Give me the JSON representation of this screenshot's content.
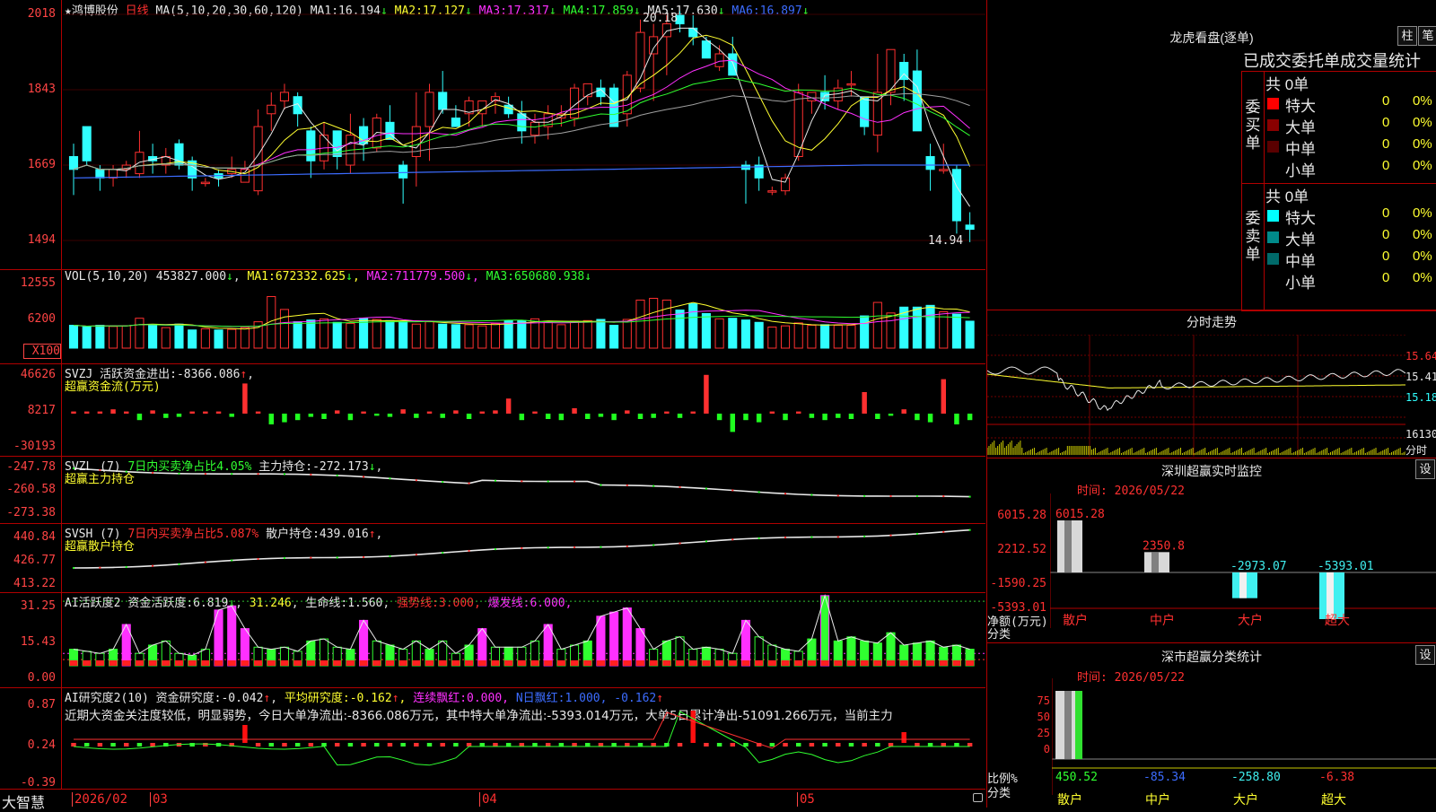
{
  "colors": {
    "up": "#ff3030",
    "down": "#30ffff",
    "ma1": "#e8e8e8",
    "ma2": "#ffff30",
    "ma3": "#ff30ff",
    "ma4": "#30ff30",
    "ma5": "#a0a0a0",
    "ma6": "#3c6cff",
    "grid": "#b00000"
  },
  "main": {
    "star": "★",
    "stock_name": "鸿博股份",
    "period": "日线",
    "ma_params": "MA(5,10,20,30,60,120)",
    "ma": [
      {
        "label": "MA1:",
        "value": "16.194"
      },
      {
        "label": "MA2:",
        "value": "17.127"
      },
      {
        "label": "MA3:",
        "value": "17.317"
      },
      {
        "label": "MA4:",
        "value": "17.859"
      },
      {
        "label": "MA5:",
        "value": "17.630"
      },
      {
        "label": "MA6:",
        "value": "16.897"
      }
    ],
    "arrow_down": "↓",
    "arrow_up": "↑",
    "ticks": [
      "2018",
      "1843",
      "1669",
      "1494"
    ],
    "high_label": "20.18",
    "low_label": "14.94"
  },
  "candles": [
    [
      16.9,
      17.2,
      16.0,
      16.6
    ],
    [
      17.6,
      17.3,
      16.7,
      16.8
    ],
    [
      16.6,
      16.7,
      16.1,
      16.4
    ],
    [
      16.4,
      16.7,
      16.2,
      16.6
    ],
    [
      16.6,
      16.8,
      16.4,
      16.7
    ],
    [
      16.5,
      17.5,
      16.4,
      17.0
    ],
    [
      16.9,
      17.2,
      16.5,
      16.8
    ],
    [
      16.7,
      17.1,
      16.5,
      16.9
    ],
    [
      17.2,
      17.3,
      16.6,
      16.7
    ],
    [
      16.8,
      16.9,
      16.1,
      16.4
    ],
    [
      16.3,
      16.4,
      16.2,
      16.3
    ],
    [
      16.5,
      16.6,
      16.2,
      16.4
    ],
    [
      16.5,
      16.9,
      16.4,
      16.6
    ],
    [
      16.3,
      16.8,
      16.3,
      16.6
    ],
    [
      16.1,
      18.0,
      16.0,
      17.6
    ],
    [
      17.9,
      18.4,
      17.5,
      18.1
    ],
    [
      18.2,
      18.6,
      18.0,
      18.4
    ],
    [
      18.3,
      18.4,
      17.6,
      17.9
    ],
    [
      17.5,
      17.6,
      16.4,
      16.8
    ],
    [
      16.8,
      17.7,
      16.6,
      17.4
    ],
    [
      17.5,
      17.5,
      16.6,
      16.9
    ],
    [
      16.7,
      17.9,
      16.5,
      17.4
    ],
    [
      17.6,
      17.8,
      16.8,
      17.2
    ],
    [
      17.1,
      17.9,
      17.0,
      17.8
    ],
    [
      17.7,
      18.1,
      17.4,
      17.3
    ],
    [
      16.7,
      16.8,
      15.8,
      16.4
    ],
    [
      16.9,
      18.4,
      16.2,
      17.6
    ],
    [
      17.6,
      18.6,
      16.8,
      18.4
    ],
    [
      18.4,
      18.9,
      17.9,
      18.0
    ],
    [
      17.8,
      18.1,
      17.6,
      17.6
    ],
    [
      17.9,
      18.3,
      17.6,
      18.2
    ],
    [
      17.9,
      18.2,
      17.6,
      18.2
    ],
    [
      18.2,
      18.4,
      17.9,
      18.3
    ],
    [
      18.1,
      18.3,
      17.8,
      17.9
    ],
    [
      17.9,
      18.2,
      17.2,
      17.5
    ],
    [
      17.4,
      17.9,
      17.2,
      17.7
    ],
    [
      17.6,
      18.1,
      17.3,
      17.9
    ],
    [
      17.8,
      18.1,
      17.6,
      17.9
    ],
    [
      17.8,
      18.6,
      17.6,
      18.5
    ],
    [
      18.3,
      18.6,
      18.1,
      18.6
    ],
    [
      18.5,
      18.7,
      18.1,
      18.3
    ],
    [
      18.5,
      18.6,
      17.6,
      17.6
    ],
    [
      17.9,
      18.9,
      17.6,
      18.8
    ],
    [
      18.5,
      20.1,
      18.4,
      19.8
    ],
    [
      19.3,
      20.0,
      18.2,
      19.7
    ],
    [
      19.7,
      20.2,
      18.8,
      20.0
    ],
    [
      20.2,
      20.3,
      19.8,
      20.0
    ],
    [
      19.9,
      20.2,
      19.5,
      19.7
    ],
    [
      19.6,
      19.7,
      19.2,
      19.2
    ],
    [
      19.0,
      19.5,
      18.9,
      19.3
    ],
    [
      19.3,
      19.7,
      18.8,
      18.8
    ],
    [
      16.7,
      16.8,
      15.8,
      16.6
    ],
    [
      16.7,
      16.9,
      16.1,
      16.4
    ],
    [
      16.1,
      16.2,
      16.0,
      16.1
    ],
    [
      16.1,
      16.5,
      16.0,
      16.4
    ],
    [
      16.9,
      18.6,
      16.8,
      18.4
    ],
    [
      18.2,
      18.4,
      17.9,
      18.4
    ],
    [
      18.4,
      18.8,
      18.0,
      18.2
    ],
    [
      18.2,
      18.7,
      18.0,
      18.5
    ],
    [
      18.6,
      18.9,
      18.3,
      18.6
    ],
    [
      18.3,
      18.3,
      17.4,
      17.6
    ],
    [
      17.4,
      19.3,
      17.0,
      18.4
    ],
    [
      18.4,
      19.4,
      18.1,
      19.4
    ],
    [
      19.1,
      19.3,
      18.2,
      18.7
    ],
    [
      18.9,
      19.4,
      17.8,
      17.5
    ],
    [
      16.9,
      17.2,
      16.1,
      16.6
    ],
    [
      16.6,
      17.2,
      16.5,
      16.6
    ],
    [
      16.6,
      16.7,
      15.1,
      15.4
    ],
    [
      15.3,
      15.6,
      14.9,
      15.2
    ]
  ],
  "volume": {
    "header": {
      "params": "VOL(5,10,20)",
      "value": "453827.000",
      "ma1_label": "MA1:",
      "ma1": "672332.625",
      "ma2_label": "MA2:",
      "ma2": "711779.500",
      "ma3_label": "MA3:",
      "ma3": "650680.938"
    },
    "ticks": [
      "12555",
      "6200",
      "X100"
    ],
    "values": [
      3900,
      3600,
      3900,
      3700,
      3800,
      5100,
      4000,
      3500,
      4100,
      3100,
      3300,
      3100,
      3200,
      3500,
      4500,
      8800,
      6600,
      4500,
      4800,
      5000,
      4400,
      4200,
      5100,
      4900,
      4700,
      4500,
      4100,
      4500,
      4100,
      4000,
      4000,
      3800,
      4200,
      4700,
      4700,
      5000,
      4600,
      4000,
      4600,
      4700,
      4900,
      3900,
      4900,
      8200,
      8500,
      8200,
      6500,
      7600,
      5900,
      5000,
      5100,
      4800,
      4400,
      3600,
      3800,
      4300,
      3900,
      4000,
      3900,
      3900,
      5500,
      7800,
      6000,
      7000,
      7000,
      7300,
      6200,
      5800,
      4600
    ]
  },
  "svzj": {
    "name": "SVZJ",
    "label": "活跃资金进出:",
    "value": "-8366.086",
    "line2": "超赢资金流(万元)",
    "ticks": [
      "46626",
      "8217",
      "-30193"
    ],
    "values": [
      2,
      2,
      2,
      4,
      2,
      -6,
      3,
      -4,
      -3,
      2,
      2,
      2,
      -3,
      28,
      2,
      -10,
      -8,
      -6,
      -3,
      -5,
      3,
      -6,
      2,
      -2,
      -3,
      4,
      -4,
      2,
      -4,
      3,
      -5,
      2,
      3,
      14,
      -6,
      2,
      -5,
      -6,
      5,
      -5,
      -3,
      -6,
      3,
      -5,
      -4,
      2,
      -4,
      2,
      36,
      -6,
      -17,
      -6,
      -8,
      2,
      -6,
      2,
      -4,
      -6,
      -4,
      -5,
      20,
      -5,
      -2,
      4,
      -6,
      -8,
      32,
      -10,
      -6,
      -3,
      -6,
      -5,
      -5
    ]
  },
  "svzl": {
    "name": "SVZL",
    "params": "(7)",
    "label1": "7日内买卖净占比4.05%",
    "label2": "主力持仓:",
    "value": "-272.173",
    "line2": "超赢主力持仓",
    "ticks": [
      "-247.78",
      "-260.58",
      "-273.38"
    ]
  },
  "svsh": {
    "name": "SVSH",
    "params": "(7)",
    "label1": "7日内买卖净占比5.087%",
    "label2": "散户持仓:",
    "value": "439.016",
    "line2": "超赢散户持仓",
    "ticks": [
      "440.84",
      "426.77",
      "413.22"
    ]
  },
  "ai_active": {
    "name": "AI活跃度2",
    "label": "资金活跃度:",
    "value": "6.819",
    "value2": "31.246",
    "label3": "生命线:",
    "value3": "1.560",
    "label4": "强势线:",
    "value4": "3.000",
    "label5": "爆发线:",
    "value5": "6.000",
    "ticks": [
      "31.25",
      "15.43",
      "0.00"
    ],
    "values": [
      8,
      7,
      6,
      8,
      20,
      6,
      10,
      12,
      6,
      5,
      8,
      27,
      29,
      18,
      9,
      8,
      9,
      7,
      12,
      13,
      9,
      8,
      22,
      12,
      10,
      8,
      12,
      8,
      12,
      6,
      10,
      18,
      9,
      9,
      9,
      12,
      20,
      8,
      10,
      12,
      24,
      26,
      28,
      18,
      8,
      12,
      14,
      8,
      9,
      8,
      6,
      22,
      14,
      10,
      8,
      7,
      13,
      34,
      12,
      14,
      12,
      11,
      16,
      10,
      11,
      12,
      9,
      10,
      8,
      7
    ]
  },
  "ai_research": {
    "name": "AI研究度2(10)",
    "label": "资金研究度:",
    "value": "-0.042",
    "label2": "平均研究度:",
    "value2": "-0.162",
    "label3": "连续飘红:",
    "value3": "0.000",
    "label4": "N日飘红:",
    "value4": "1.000",
    "value5": "-0.162",
    "text": "近期大资金关注度较低，明显弱势，今日大单净流出:-8366.086万元，其中特大单净流出:-5393.014万元，大单5日累计净出-51091.266万元，当前主力",
    "ticks": [
      "0.87",
      "0.24",
      "-0.39"
    ]
  },
  "xaxis": {
    "brand": "大智慧",
    "labels": [
      "2026/02",
      "03",
      "04",
      "05"
    ]
  },
  "lhb": {
    "title": "龙虎看盘(逐单)",
    "btn1": "柱",
    "btn2": "笔",
    "subtitle": "已成交委托单成交量统计",
    "buy": {
      "side": "委买单",
      "total": "共 0单",
      "rows": [
        {
          "name": "特大",
          "val": "0",
          "pct": "0%",
          "color": "#ff0000"
        },
        {
          "name": "大单",
          "val": "0",
          "pct": "0%",
          "color": "#8a0000"
        },
        {
          "name": "中单",
          "val": "0",
          "pct": "0%",
          "color": "#5a0000"
        },
        {
          "name": "小单",
          "val": "0",
          "pct": "0%",
          "color": "#000000"
        }
      ]
    },
    "sell": {
      "side": "委卖单",
      "total": "共 0单",
      "rows": [
        {
          "name": "特大",
          "val": "0",
          "pct": "0%",
          "color": "#00ffff"
        },
        {
          "name": "大单",
          "val": "0",
          "pct": "0%",
          "color": "#008a8a"
        },
        {
          "name": "中单",
          "val": "0",
          "pct": "0%",
          "color": "#006a6a"
        },
        {
          "name": "小单",
          "val": "0",
          "pct": "0%",
          "color": "#000000"
        }
      ]
    }
  },
  "intraday": {
    "title": "分时走势",
    "ticks": [
      "15.64",
      "15.41",
      "15.18",
      "16130",
      "分时"
    ]
  },
  "monitor": {
    "title": "深圳超赢实时监控",
    "btn": "设",
    "time": "时间: 2026/05/22",
    "ticks": [
      "6015.28",
      "2212.52",
      "-1590.25",
      "-5393.01"
    ],
    "unit": "净额(万元)",
    "cat_label": "分类",
    "bars": [
      {
        "name": "散户",
        "value": 6015.28,
        "label": "6015.28"
      },
      {
        "name": "中户",
        "value": 2350.8,
        "label": "2350.8"
      },
      {
        "name": "大户",
        "value": -2973.07,
        "label": "-2973.07"
      },
      {
        "name": "超大",
        "value": -5393.01,
        "label": "-5393.01"
      }
    ]
  },
  "classify": {
    "title": "深市超赢分类统计",
    "btn": "设",
    "time": "时间: 2026/05/22",
    "ticks": [
      "75",
      "50",
      "25",
      "0"
    ],
    "unit": "比例%",
    "cat_label": "分类",
    "items": [
      {
        "name": "散户",
        "value": "450.52"
      },
      {
        "name": "中户",
        "value": "-85.34"
      },
      {
        "name": "大户",
        "value": "-258.80"
      },
      {
        "name": "超大",
        "value": "-6.38"
      }
    ]
  },
  "chart_data": {
    "type": "candlestick",
    "title": "鸿博股份 日线",
    "ylim": [
      14.94,
      20.18
    ],
    "ma": {
      "MA1": 16.194,
      "MA2": 17.127,
      "MA3": 17.317,
      "MA4": 17.859,
      "MA5": 17.63,
      "MA6": 16.897
    },
    "x_labels": [
      "2026/02",
      "03",
      "04",
      "05"
    ]
  }
}
